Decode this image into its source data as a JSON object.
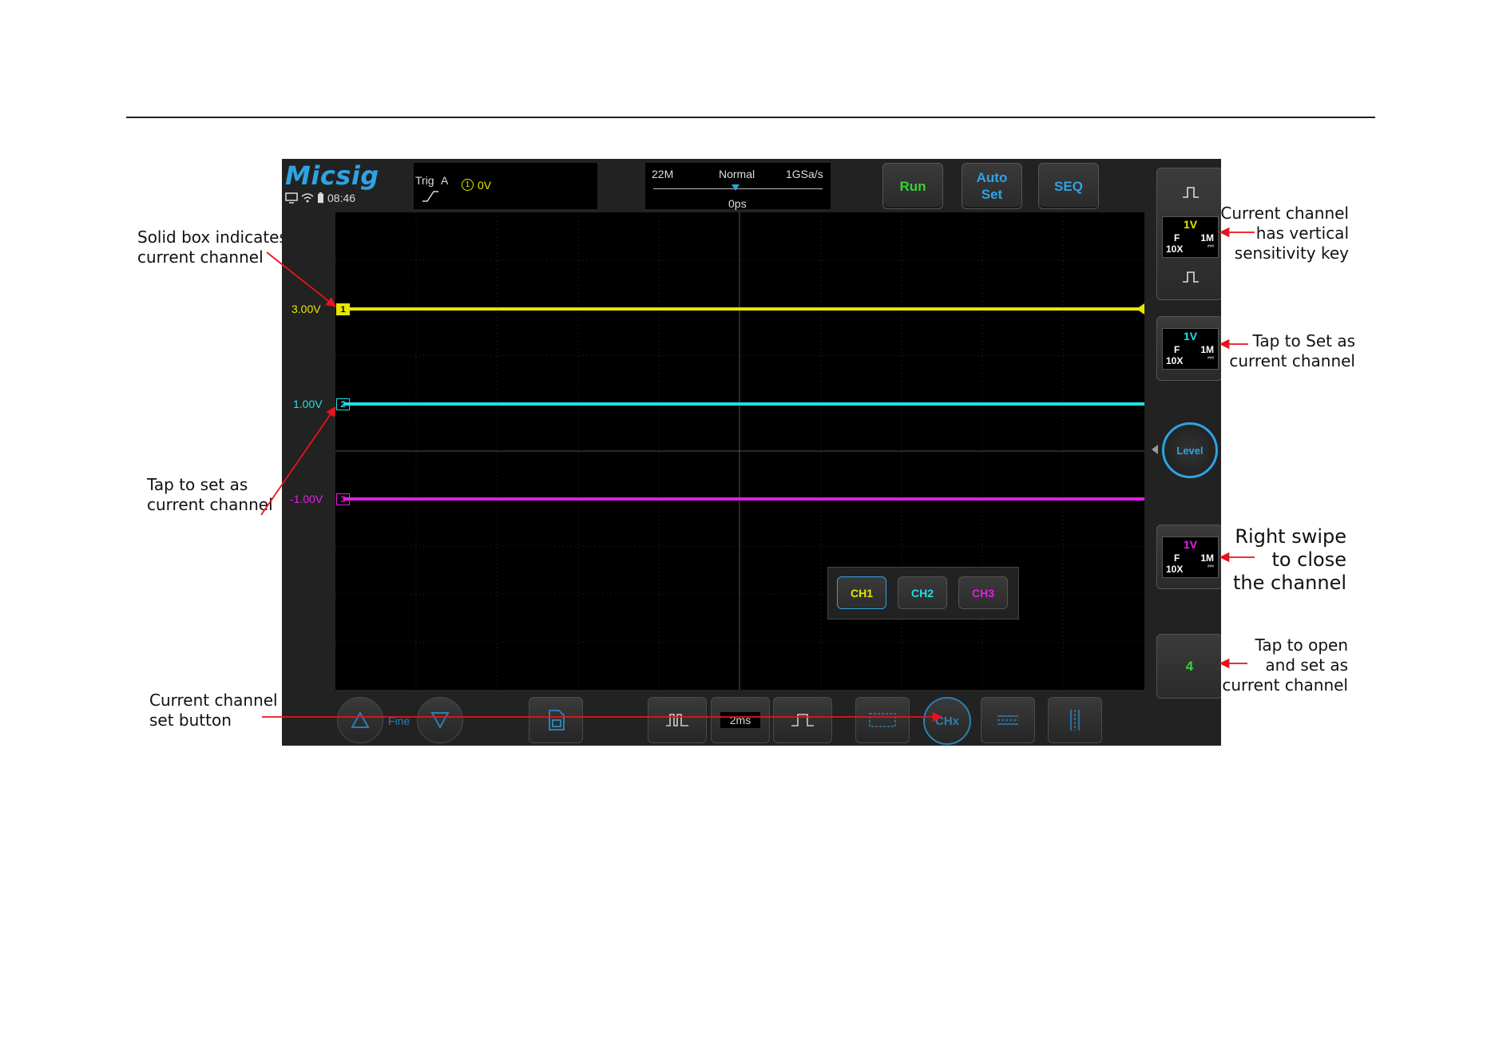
{
  "annotations": {
    "left": [
      {
        "lines": [
          "Solid box indicates",
          "current channel"
        ]
      },
      {
        "lines": [
          "Tap to set as",
          "current channel"
        ]
      },
      {
        "lines": [
          "Current channel",
          "set button"
        ]
      }
    ],
    "right": [
      {
        "lines": [
          "Current channel",
          "has vertical",
          "sensitivity key"
        ]
      },
      {
        "lines": [
          "Tap to Set as",
          "current channel"
        ]
      },
      {
        "lines": [
          "Right swipe",
          "to close",
          "the channel"
        ]
      },
      {
        "lines": [
          "Tap to open",
          "and set as",
          "current channel"
        ]
      }
    ]
  },
  "scope": {
    "logo": "Micsig",
    "clock": "08:46",
    "status_icons": [
      "monitor-icon",
      "wifi-icon",
      "battery-icon"
    ],
    "trigger": {
      "label": "Trig",
      "source": "A",
      "channel_marker": "1",
      "level": "0V",
      "edge": "rising-edge-icon"
    },
    "timebase_header": {
      "bandwidth": "22M",
      "mode": "Normal",
      "sample_rate": "1GSa/s",
      "position": "0ps"
    },
    "buttons": {
      "run": "Run",
      "auto_set_line1": "Auto",
      "auto_set_line2": "Set",
      "seq": "SEQ"
    },
    "channels": [
      {
        "id": "1",
        "offset_label": "3.00V",
        "color": "#e6e600",
        "sensitivity": "1V",
        "coupling": "F",
        "probe": "10X",
        "impedance": "1M",
        "current": true
      },
      {
        "id": "2",
        "offset_label": "1.00V",
        "color": "#1ee0e8",
        "sensitivity": "1V",
        "coupling": "F",
        "probe": "10X",
        "impedance": "1M",
        "current": false
      },
      {
        "id": "3",
        "offset_label": "-1.00V",
        "color": "#e020e0",
        "sensitivity": "1V",
        "coupling": "F",
        "probe": "10X",
        "impedance": "1M",
        "current": false
      }
    ],
    "level_button": "Level",
    "open_channel_button": "4",
    "channel_selector": [
      "CH1",
      "CH2",
      "CH3"
    ],
    "bottom": {
      "fine": "Fine",
      "timebase": "2ms",
      "chx": "CHx"
    },
    "colors": {
      "accent": "#2ea3e3",
      "run": "#36d236",
      "annotation_arrow": "#e8131b"
    }
  }
}
